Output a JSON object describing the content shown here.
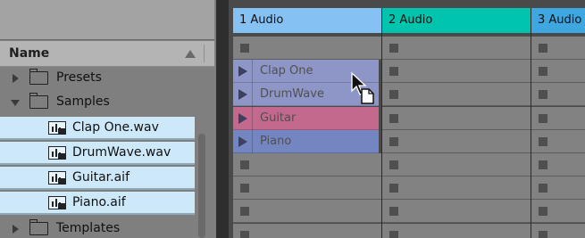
{
  "browser": {
    "column_header": "Name",
    "items": [
      {
        "label": "Presets",
        "kind": "folder",
        "expanded": false
      },
      {
        "label": "Samples",
        "kind": "folder",
        "expanded": true
      },
      {
        "label": "Clap One.wav",
        "kind": "audio-file",
        "selected": true
      },
      {
        "label": "DrumWave.wav",
        "kind": "audio-file",
        "selected": true
      },
      {
        "label": "Guitar.aif",
        "kind": "audio-file",
        "selected": true
      },
      {
        "label": "Piano.aif",
        "kind": "audio-file",
        "selected": true
      },
      {
        "label": "Templates",
        "kind": "folder",
        "expanded": false
      }
    ]
  },
  "tracks": [
    {
      "name": "1 Audio",
      "color": "#86c1f4"
    },
    {
      "name": "2 Audio",
      "color": "#00c4ad"
    },
    {
      "name": "3 Audio",
      "color": "#3ea7e0"
    }
  ],
  "clips": [
    {
      "name": "Clap One",
      "color": "#8d96c6"
    },
    {
      "name": "DrumWave",
      "color": "#8d96c6"
    },
    {
      "name": "Guitar",
      "color": "#c2698d"
    },
    {
      "name": "Piano",
      "color": "#7386c2"
    }
  ],
  "colors": {
    "selection": "#cde8f8",
    "browser_bg": "#7f7f7f",
    "slot_bg": "#828282"
  },
  "cursor": {
    "icon": "drag-file-cursor-icon"
  }
}
